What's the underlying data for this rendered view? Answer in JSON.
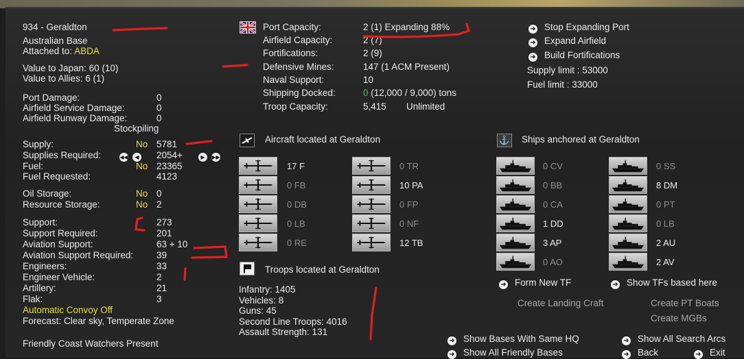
{
  "base": {
    "name": "934 - Geraldton",
    "type": "Australian Base",
    "attached_label": "Attached to:",
    "attached_value": "ABDA",
    "value_japan": "Value to Japan: 60 (10)",
    "value_allies": "Value to Allies: 6 (1)"
  },
  "damage": [
    {
      "label": "Port Damage:",
      "value": "0"
    },
    {
      "label": "Airfield Service Damage:",
      "value": "0"
    },
    {
      "label": "Airfield Runway Damage:",
      "value": "0"
    }
  ],
  "stockpiling_label": "Stockpiling",
  "supply": {
    "supply_label": "Supply:",
    "supply_flag": "No",
    "supply_value": "5781",
    "req_label": "Supplies Required:",
    "req_value": "2054+",
    "fuel_label": "Fuel:",
    "fuel_flag": "No",
    "fuel_value": "23365",
    "fuelreq_label": "Fuel Requested:",
    "fuelreq_value": "4123",
    "oil_label": "Oil Storage:",
    "oil_flag": "No",
    "oil_value": "0",
    "res_label": "Resource Storage:",
    "res_flag": "No",
    "res_value": "2"
  },
  "support": [
    {
      "label": "Support:",
      "value": "273"
    },
    {
      "label": "Support Required:",
      "value": "201"
    },
    {
      "label": "Aviation Support:",
      "value": "63 + 10"
    },
    {
      "label": "Aviation Support Required:",
      "value": "39"
    },
    {
      "label": "Engineers:",
      "value": "33"
    },
    {
      "label": "Engineer Vehicle:",
      "value": "2"
    },
    {
      "label": "Artillery:",
      "value": "21"
    },
    {
      "label": "Flak:",
      "value": "3"
    }
  ],
  "convoy": "Automatic Convoy Off",
  "forecast": "Forecast: Clear sky, Temperate Zone",
  "coast_watchers": "Friendly Coast Watchers Present",
  "port": {
    "rows": [
      {
        "label": "Port Capacity:",
        "value": "2 (1) Expanding 88%"
      },
      {
        "label": "Airfield Capacity:",
        "value": "2 (7)"
      },
      {
        "label": "Fortifications:",
        "value": "2 (9)"
      },
      {
        "label": "Defensive Mines:",
        "value": "147 (1 ACM Present)"
      },
      {
        "label": "Naval Support:",
        "value": "10"
      },
      {
        "label": "Shipping Docked:",
        "value_green": "0",
        "value": "(12,000 / 9,000) tons"
      },
      {
        "label": "Troop Capacity:",
        "value": "5,415",
        "extra": "Unlimited"
      }
    ]
  },
  "actions": {
    "stop_port": "Stop Expanding Port",
    "expand_airfield": "Expand Airfield",
    "build_forts": "Build Fortifications",
    "supply_limit": "Supply limit : 53000",
    "fuel_limit": "Fuel limit : 33000"
  },
  "aircraft": {
    "header": "Aircraft located at Geraldton",
    "left": [
      "17 F",
      "0 FB",
      "0 DB",
      "0 LB",
      "0 RE"
    ],
    "right": [
      "0 TR",
      "10 PA",
      "0 FP",
      "0 NF",
      "12 TB"
    ]
  },
  "troops": {
    "header": "Troops located at Geraldton",
    "lines": [
      "Infantry: 1405",
      "Vehicles: 8",
      "Guns: 45",
      "Second Line Troops: 4016",
      "Assault Strength: 131"
    ]
  },
  "ships": {
    "header": "Ships anchored at Geraldton",
    "left": [
      "0 CV",
      "0 BB",
      "0 CA",
      "1 DD",
      "3 AP",
      "0 AO"
    ],
    "right": [
      "0 SS",
      "8 DM",
      "0 PT",
      "0 LB",
      "2 AU",
      "2 AV"
    ]
  },
  "bottom": {
    "form_tf": "Form New TF",
    "show_tfs": "Show TFs based here",
    "landing_craft": "Create Landing Craft",
    "pt_boats": "Create PT Boats",
    "mcbs": "Create MGBs",
    "same_hq": "Show Bases With Same HQ",
    "friendly_bases": "Show All Friendly Bases",
    "search_arcs": "Show All Search Arcs",
    "back": "Back",
    "exit": "Exit"
  },
  "colors": {
    "annotation_red": "#e02020",
    "highlight_yellow": "#e7df4a",
    "docked_green": "#3cc83c"
  }
}
